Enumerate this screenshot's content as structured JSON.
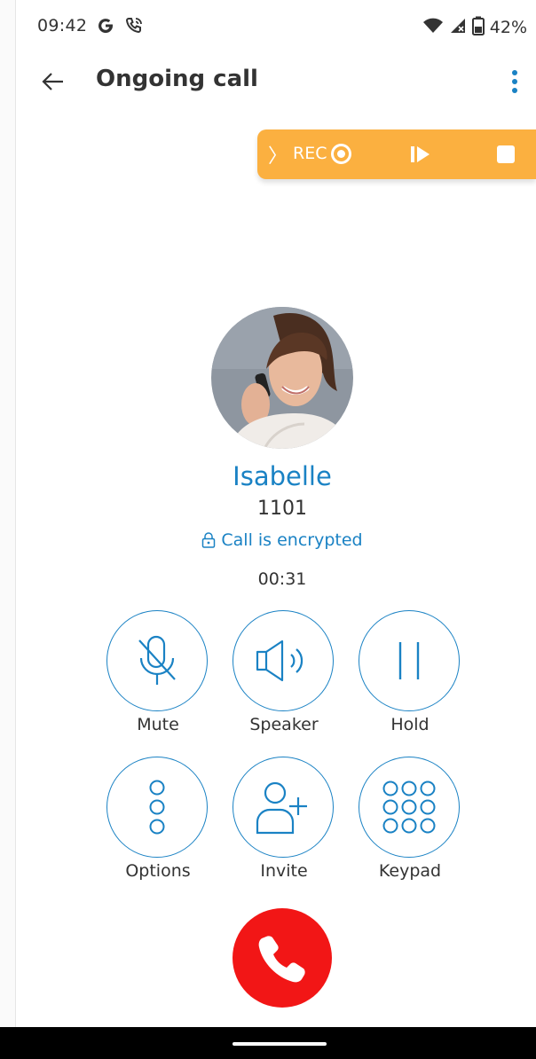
{
  "status_bar": {
    "time": "09:42",
    "battery": "42%",
    "icons": [
      "google-icon",
      "phone-call-icon",
      "wifi-icon",
      "signal-icon",
      "battery-icon"
    ]
  },
  "app_bar": {
    "title": "Ongoing call",
    "back_icon": "arrow-left-icon",
    "menu_icon": "more-vertical-icon"
  },
  "recording": {
    "label": "REC",
    "icons": [
      "chevron-right-icon",
      "record-icon",
      "resume-icon",
      "stop-icon"
    ],
    "color": "#fbb040"
  },
  "caller": {
    "name": "Isabelle",
    "number": "1101",
    "encryption": "Call is encrypted",
    "duration": "00:31"
  },
  "actions": [
    {
      "label": "Mute",
      "icon": "mic-off-icon"
    },
    {
      "label": "Speaker",
      "icon": "speaker-icon"
    },
    {
      "label": "Hold",
      "icon": "pause-icon"
    },
    {
      "label": "Options",
      "icon": "options-icon"
    },
    {
      "label": "Invite",
      "icon": "add-person-icon"
    },
    {
      "label": "Keypad",
      "icon": "dialpad-icon"
    }
  ],
  "end_call": {
    "icon": "phone-hangup-icon",
    "color": "#f21616"
  },
  "colors": {
    "accent": "#1a82c4",
    "text": "#333333"
  }
}
